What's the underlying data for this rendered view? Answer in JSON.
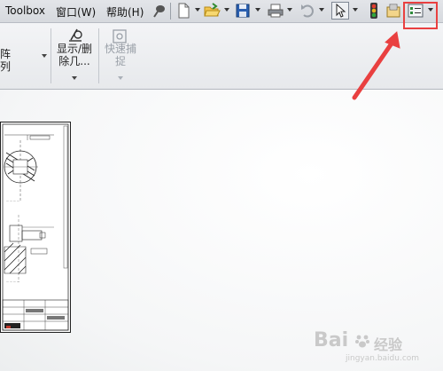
{
  "menu": {
    "toolbox": "Toolbox",
    "window": "窗口(W)",
    "help": "帮助(H)"
  },
  "quick_toolbar": {
    "icons": [
      "pin-icon",
      "new-document-icon",
      "open-folder-icon",
      "save-icon",
      "print-icon",
      "undo-icon",
      "select-cursor-icon",
      "rebuild-traffic-light-icon",
      "file-properties-icon",
      "options-icon"
    ]
  },
  "ribbon": {
    "pattern_label": "阵列",
    "show_delete_label_line1": "显示/删",
    "show_delete_label_line2": "除几...",
    "quick_snap_label_line1": "快速捕",
    "quick_snap_label_line2": "捉"
  },
  "annotation": {
    "highlight_color": "#e94040",
    "arrow_color": "#e94040"
  },
  "watermark": {
    "brand": "Bai",
    "brand_cn": "经验",
    "domain": "jingyan.baidu.com"
  }
}
